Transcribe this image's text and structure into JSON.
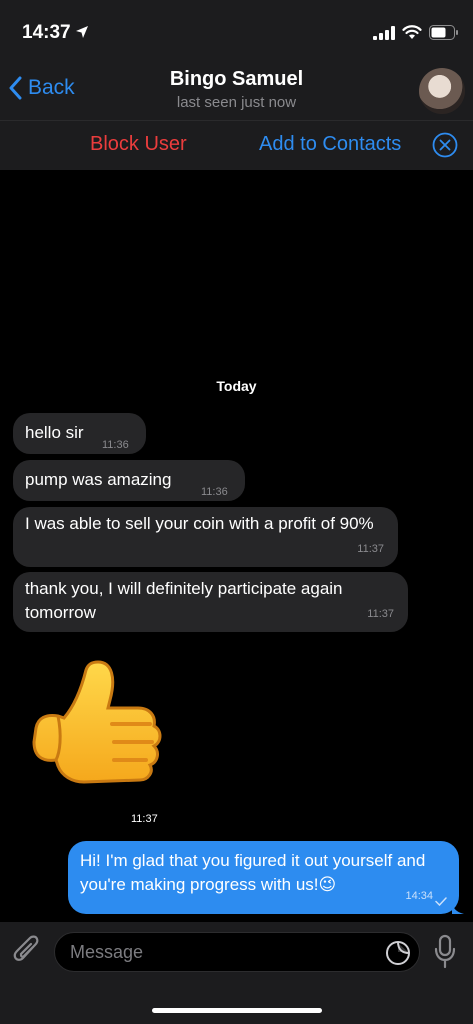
{
  "status": {
    "time": "14:37"
  },
  "header": {
    "back_label": "Back",
    "title": "Bingo Samuel",
    "subtitle": "last seen just now"
  },
  "actions": {
    "block_label": "Block User",
    "add_label": "Add to Contacts"
  },
  "chat": {
    "date_separator": "Today",
    "incoming": [
      {
        "text": "hello sir",
        "time": "11:36"
      },
      {
        "text": "pump was amazing",
        "time": "11:36"
      },
      {
        "text": "I was able to sell your coin with a profit of 90%",
        "time": "11:37"
      },
      {
        "text": "thank you, I will definitely participate again tomorrow",
        "time": "11:37"
      }
    ],
    "sticker_time": "11:37",
    "outgoing": {
      "text": "Hi! I'm glad that you figured it out yourself and you're making progress with us!😉",
      "time": "14:34"
    }
  },
  "input": {
    "placeholder": "Message"
  },
  "colors": {
    "accent": "#2e8cf0",
    "danger": "#eb3d3d",
    "bubble_in": "#262628",
    "bubble_out": "#2d8cf0"
  },
  "icons": [
    "location-arrow-icon",
    "signal-icon",
    "wifi-icon",
    "battery-icon",
    "chevron-left-icon",
    "close-circle-icon",
    "paperclip-icon",
    "sticker-icon",
    "microphone-icon",
    "check-icon",
    "thumbs-up-sticker"
  ]
}
